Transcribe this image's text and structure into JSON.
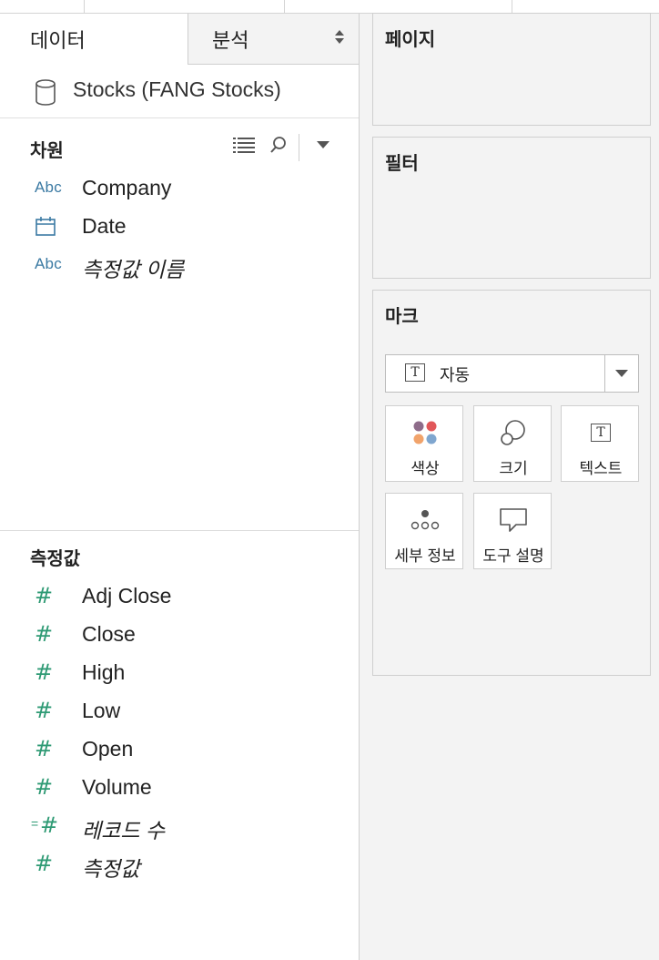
{
  "tabs": {
    "data": "데이터",
    "analysis": "분석"
  },
  "datasource": {
    "name": "Stocks (FANG Stocks)"
  },
  "dimensions": {
    "title": "차원",
    "fields": [
      {
        "label": "Company",
        "type": "Abc"
      },
      {
        "label": "Date",
        "type": "date"
      },
      {
        "label": "측정값 이름",
        "type": "Abc"
      }
    ]
  },
  "measures": {
    "title": "측정값",
    "fields": [
      {
        "label": "Adj Close"
      },
      {
        "label": "Close"
      },
      {
        "label": "High"
      },
      {
        "label": "Low"
      },
      {
        "label": "Open"
      },
      {
        "label": "Volume"
      },
      {
        "label": "레코드 수"
      },
      {
        "label": "측정값"
      }
    ]
  },
  "icons": {
    "abc_text": "Abc",
    "hash": "#",
    "mark_T": "T"
  },
  "pages": {
    "title": "페이지"
  },
  "filters": {
    "title": "필터"
  },
  "marks": {
    "title": "마크",
    "type": "자동",
    "buttons": {
      "color": "색상",
      "size": "크기",
      "text": "텍스트",
      "detail": "세부 정보",
      "tooltip": "도구 설명"
    }
  },
  "colors": {
    "accent_abc": "#3b7aa3",
    "accent_measure": "#2e9a74",
    "dot_purple": "#8e6c8a",
    "dot_red": "#e15759",
    "dot_orange": "#f1a36b",
    "dot_blue": "#7fa6cf"
  }
}
